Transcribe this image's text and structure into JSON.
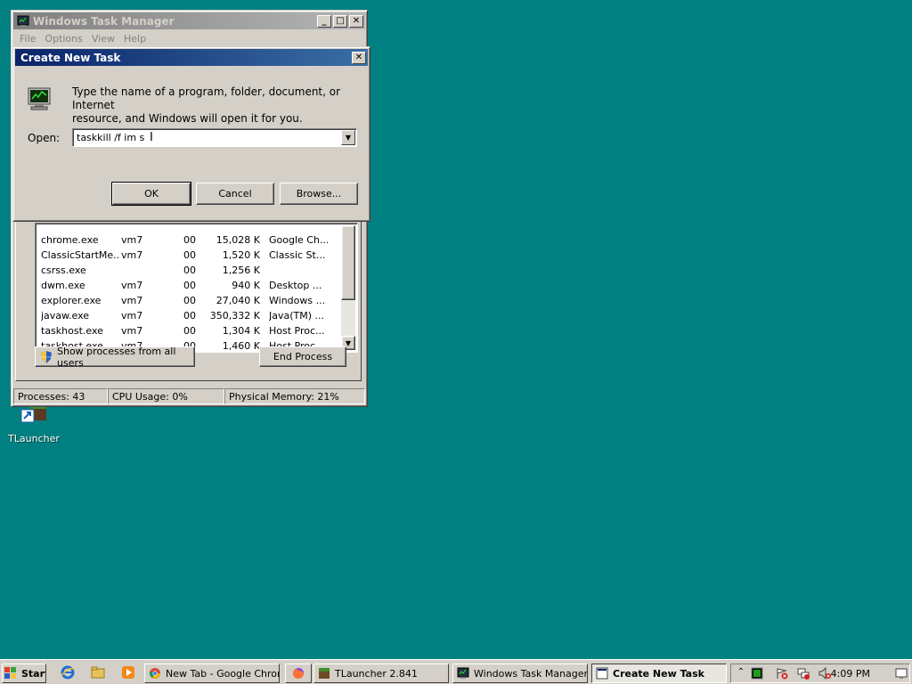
{
  "desktop": {
    "icons": [
      {
        "label": "TLauncher",
        "icon": "tlauncher-shortcut-icon"
      }
    ]
  },
  "task_manager": {
    "title": "Windows Task Manager",
    "menu": [
      "File",
      "Options",
      "View",
      "Help"
    ],
    "processes": [
      {
        "name": "chrome.exe",
        "user": "vm7",
        "cpu": "00",
        "mem": "15,028 K",
        "desc": "Google Ch..."
      },
      {
        "name": "ClassicStartMe...",
        "user": "vm7",
        "cpu": "00",
        "mem": "1,520 K",
        "desc": "Classic St..."
      },
      {
        "name": "csrss.exe",
        "user": "",
        "cpu": "00",
        "mem": "1,256 K",
        "desc": ""
      },
      {
        "name": "dwm.exe",
        "user": "vm7",
        "cpu": "00",
        "mem": "940 K",
        "desc": "Desktop ..."
      },
      {
        "name": "explorer.exe",
        "user": "vm7",
        "cpu": "00",
        "mem": "27,040 K",
        "desc": "Windows ..."
      },
      {
        "name": "javaw.exe",
        "user": "vm7",
        "cpu": "00",
        "mem": "350,332 K",
        "desc": "Java(TM) ..."
      },
      {
        "name": "taskhost.exe",
        "user": "vm7",
        "cpu": "00",
        "mem": "1,304 K",
        "desc": "Host Proc..."
      },
      {
        "name": "taskhost.exe",
        "user": "vm7",
        "cpu": "00",
        "mem": "1,460 K",
        "desc": "Host Proc..."
      }
    ],
    "show_all_label": "Show processes from all users",
    "end_process_label": "End Process",
    "status": {
      "processes": "Processes: 43",
      "cpu": "CPU Usage: 0%",
      "memory": "Physical Memory: 21%"
    }
  },
  "dialog": {
    "title": "Create New Task",
    "message_line1": "Type the name of a program, folder, document, or Internet",
    "message_line2": "resource, and Windows will open it for you.",
    "open_label": "Open:",
    "open_value": "taskkill /f im s",
    "ok_label": "OK",
    "cancel_label": "Cancel",
    "browse_label": "Browse..."
  },
  "taskbar": {
    "start_label": "Start",
    "quick_launch": [
      "internet-explorer-icon",
      "folder-icon",
      "media-player-icon"
    ],
    "buttons": [
      {
        "label": "New Tab - Google Chrome",
        "icon": "chrome-icon"
      },
      {
        "label": "",
        "icon": "firefox-icon"
      },
      {
        "label": "TLauncher 2.841",
        "icon": "tlauncher-icon"
      },
      {
        "label": "Windows Task Manager",
        "icon": "task-manager-icon"
      },
      {
        "label": "Create New Task",
        "icon": "create-task-icon"
      }
    ],
    "clock": "4:09 PM"
  }
}
